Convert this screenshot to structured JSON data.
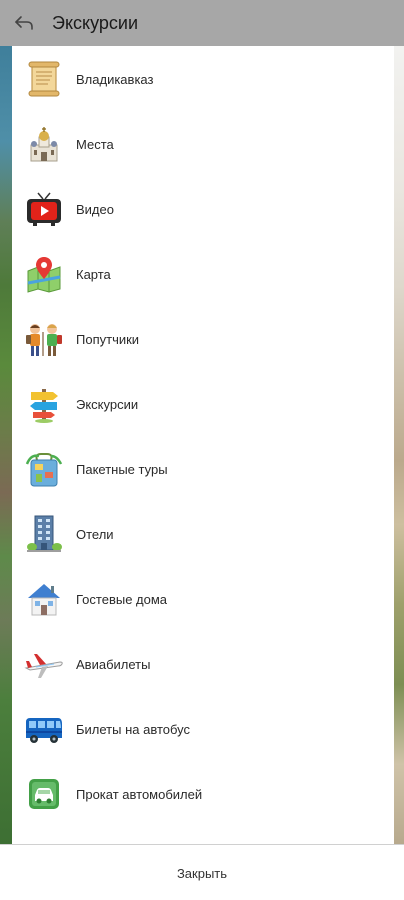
{
  "appbar": {
    "title": "Экскурсии",
    "back_icon": "back-arrow-icon"
  },
  "menu": {
    "items": [
      {
        "label": "Владикавказ",
        "icon": "scroll-icon"
      },
      {
        "label": "Места",
        "icon": "church-icon"
      },
      {
        "label": "Видео",
        "icon": "video-tv-icon"
      },
      {
        "label": "Карта",
        "icon": "map-pin-icon"
      },
      {
        "label": "Попутчики",
        "icon": "travelers-icon"
      },
      {
        "label": "Экскурсии",
        "icon": "signpost-icon"
      },
      {
        "label": "Пакетные туры",
        "icon": "suitcase-icon"
      },
      {
        "label": "Отели",
        "icon": "hotel-building-icon"
      },
      {
        "label": "Гостевые дома",
        "icon": "house-icon"
      },
      {
        "label": "Авиабилеты",
        "icon": "airplane-icon"
      },
      {
        "label": "Билеты на автобус",
        "icon": "bus-icon"
      },
      {
        "label": "Прокат автомобилей",
        "icon": "car-rental-icon"
      }
    ]
  },
  "footer": {
    "close_label": "Закрыть"
  },
  "colors": {
    "appbar_bg": "#a7a7a7",
    "panel_bg": "#ffffff"
  }
}
